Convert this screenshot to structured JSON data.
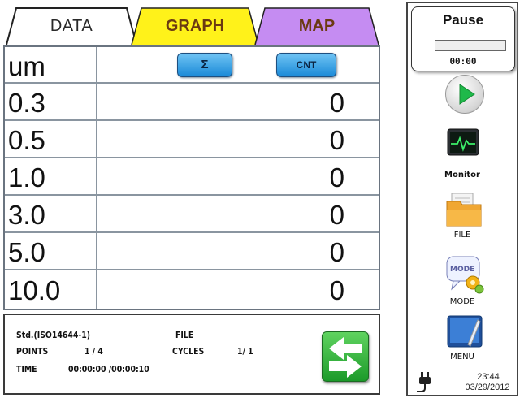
{
  "tabs": [
    {
      "label": "DATA"
    },
    {
      "label": "GRAPH"
    },
    {
      "label": "MAP"
    }
  ],
  "table": {
    "header": {
      "unit": "um",
      "sum_button": "Σ",
      "count_button": "CNT"
    },
    "rows": [
      {
        "size": "0.3",
        "count": "0"
      },
      {
        "size": "0.5",
        "count": "0"
      },
      {
        "size": "1.0",
        "count": "0"
      },
      {
        "size": "3.0",
        "count": "0"
      },
      {
        "size": "5.0",
        "count": "0"
      },
      {
        "size": "10.0",
        "count": "0"
      }
    ]
  },
  "info": {
    "standard": "Std.(ISO14644-1)",
    "file_label": "FILE",
    "points_label": "POINTS",
    "points_value": "1 / 4",
    "cycles_label": "CYCLES",
    "cycles_value": "1/ 1",
    "time_label": "TIME",
    "time_value": "00:00:00 /00:00:10"
  },
  "sidebar": {
    "status_label": "Pause",
    "timer": "00:00",
    "monitor_label": "Monitor",
    "file_label": "FILE",
    "mode_label": "MODE",
    "menu_label": "MENU",
    "clock_time": "23:44",
    "clock_date": "03/29/2012"
  },
  "colors": {
    "graph_tab": "#fff21a",
    "map_tab": "#c58cf2",
    "accent_blue": "#1a8ad8",
    "play_green": "#1fb94a"
  }
}
